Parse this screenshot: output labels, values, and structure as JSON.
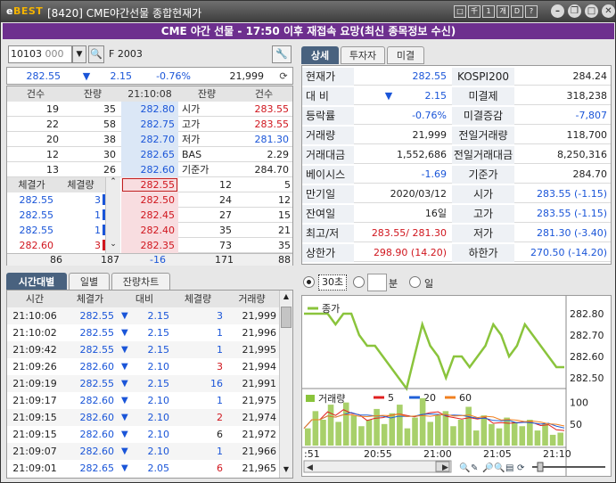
{
  "window": {
    "logo_prefix": "e",
    "logo_main": "BEST",
    "screen_id": "[8420]",
    "title": "CME야간선물 종합현재가",
    "btn_labels": [
      "□",
      "千",
      "1",
      "개",
      "D",
      "?"
    ]
  },
  "banner": "CME 야간 선물 - 17:50 이후 재접속 요망(최신 종목정보 수신)",
  "code": {
    "value": "10103",
    "sub": "000",
    "name": "F 2003"
  },
  "summary": {
    "price": "282.55",
    "arrow": "▼",
    "change": "2.15",
    "rate": "-0.76%",
    "volume": "21,999"
  },
  "hoga": {
    "headers": [
      "건수",
      "잔량",
      "21:10:08",
      "잔량",
      "건수"
    ],
    "asks": [
      {
        "cnt": "19",
        "qty": "35",
        "price": "282.80"
      },
      {
        "cnt": "22",
        "qty": "58",
        "price": "282.75"
      },
      {
        "cnt": "20",
        "qty": "38",
        "price": "282.70"
      },
      {
        "cnt": "12",
        "qty": "30",
        "price": "282.65"
      },
      {
        "cnt": "13",
        "qty": "26",
        "price": "282.60"
      }
    ],
    "info": [
      {
        "label": "시가",
        "value": "283.55"
      },
      {
        "label": "고가",
        "value": "283.55"
      },
      {
        "label": "저가",
        "value": "281.30"
      },
      {
        "label": "BAS",
        "value": "2.29"
      },
      {
        "label": "기준가",
        "value": "284.70"
      }
    ],
    "bids": [
      {
        "price": "282.55",
        "qty": "12",
        "cnt": "5"
      },
      {
        "price": "282.50",
        "qty": "24",
        "cnt": "12"
      },
      {
        "price": "282.45",
        "qty": "27",
        "cnt": "15"
      },
      {
        "price": "282.40",
        "qty": "35",
        "cnt": "21"
      },
      {
        "price": "282.35",
        "qty": "73",
        "cnt": "35"
      }
    ],
    "fill_headers": [
      "체결가",
      "체결량"
    ],
    "fills": [
      {
        "p": "282.55",
        "q": "3"
      },
      {
        "p": "282.55",
        "q": "1"
      },
      {
        "p": "282.55",
        "q": "1"
      },
      {
        "p": "282.60",
        "q": "3"
      }
    ],
    "totals": [
      "86",
      "187",
      "-16",
      "171",
      "88"
    ]
  },
  "detail_tabs": [
    "상세",
    "투자자",
    "미결"
  ],
  "detail": [
    {
      "l": "현재가",
      "v": "282.55",
      "l2": "KOSPI200",
      "v2": "284.24"
    },
    {
      "l": "대 비",
      "v": "2.15",
      "arrow": "▼",
      "l2": "미결제",
      "v2": "318,238"
    },
    {
      "l": "등락률",
      "v": "-0.76%",
      "l2": "미결증감",
      "v2": "-7,807"
    },
    {
      "l": "거래량",
      "v": "21,999",
      "l2": "전일거래량",
      "v2": "118,700"
    },
    {
      "l": "거래대금",
      "v": "1,552,686",
      "l2": "전일거래대금",
      "v2": "8,250,316"
    },
    {
      "l": "베이시스",
      "v": "-1.69",
      "l2": "기준가",
      "v2": "284.70"
    },
    {
      "l": "만기일",
      "v": "2020/03/12",
      "l2": "시가",
      "v2": "283.55 (-1.15)"
    },
    {
      "l": "잔여일",
      "v": "16일",
      "l2": "고가",
      "v2": "283.55 (-1.15)"
    },
    {
      "l": "최고/저",
      "v": "283.55/ 281.30",
      "l2": "저가",
      "v2": "281.30 (-3.40)"
    },
    {
      "l": "상한가",
      "v": "298.90 (14.20)",
      "l2": "하한가",
      "v2": "270.50 (-14.20)"
    }
  ],
  "time_tabs": [
    "시간대별",
    "일별",
    "잔량차트"
  ],
  "time_headers": [
    "시간",
    "체결가",
    "대비",
    "체결량",
    "거래량"
  ],
  "time_rows": [
    [
      "21:10:06",
      "282.55",
      "2.15",
      "3",
      "21,999"
    ],
    [
      "21:10:02",
      "282.55",
      "2.15",
      "1",
      "21,996"
    ],
    [
      "21:09:42",
      "282.55",
      "2.15",
      "1",
      "21,995"
    ],
    [
      "21:09:26",
      "282.60",
      "2.10",
      "3",
      "21,994"
    ],
    [
      "21:09:19",
      "282.55",
      "2.15",
      "16",
      "21,991"
    ],
    [
      "21:09:17",
      "282.60",
      "2.10",
      "1",
      "21,975"
    ],
    [
      "21:09:15",
      "282.60",
      "2.10",
      "2",
      "21,974"
    ],
    [
      "21:09:15",
      "282.60",
      "2.10",
      "6",
      "21,972"
    ],
    [
      "21:09:07",
      "282.60",
      "2.10",
      "1",
      "21,966"
    ],
    [
      "21:09:01",
      "282.65",
      "2.05",
      "6",
      "21,965"
    ]
  ],
  "chart_opts": {
    "sec": "30초",
    "min": "분",
    "day": "일"
  },
  "chart_data": {
    "type": "line",
    "series": [
      {
        "name": "종가",
        "values": [
          282.8,
          282.8,
          282.8,
          282.8,
          282.75,
          282.8,
          282.8,
          282.7,
          282.65,
          282.65,
          282.6,
          282.55,
          282.5,
          282.45,
          282.6,
          282.75,
          282.65,
          282.6,
          282.5,
          282.6,
          282.6,
          282.55,
          282.6,
          282.65,
          282.75,
          282.7,
          282.6,
          282.65,
          282.75,
          282.7,
          282.65,
          282.6,
          282.55,
          282.55
        ]
      }
    ],
    "ylim": [
      282.45,
      282.85
    ],
    "yticks": [
      "282.80",
      "282.70",
      "282.60",
      "282.50"
    ],
    "xticks": [
      ":51",
      "20:55",
      "21:00",
      "21:05",
      "21:10"
    ],
    "volume": {
      "name": "거래량",
      "values": [
        40,
        80,
        60,
        95,
        55,
        100,
        70,
        45,
        60,
        85,
        50,
        75,
        95,
        40,
        65,
        110,
        55,
        70,
        80,
        45,
        60,
        90,
        35,
        70,
        50,
        40,
        65,
        55,
        45,
        60,
        35,
        50,
        25,
        30
      ],
      "ma": [
        {
          "name": "5",
          "color": "#e02020"
        },
        {
          "name": "20",
          "color": "#2060d8"
        },
        {
          "name": "60",
          "color": "#f08020"
        }
      ],
      "yticks": [
        "100",
        "50"
      ]
    }
  },
  "colors": {
    "accent": "#6d2f8e",
    "green": "#8ac43c",
    "up": "#d0161e",
    "down": "#1a55d8"
  }
}
